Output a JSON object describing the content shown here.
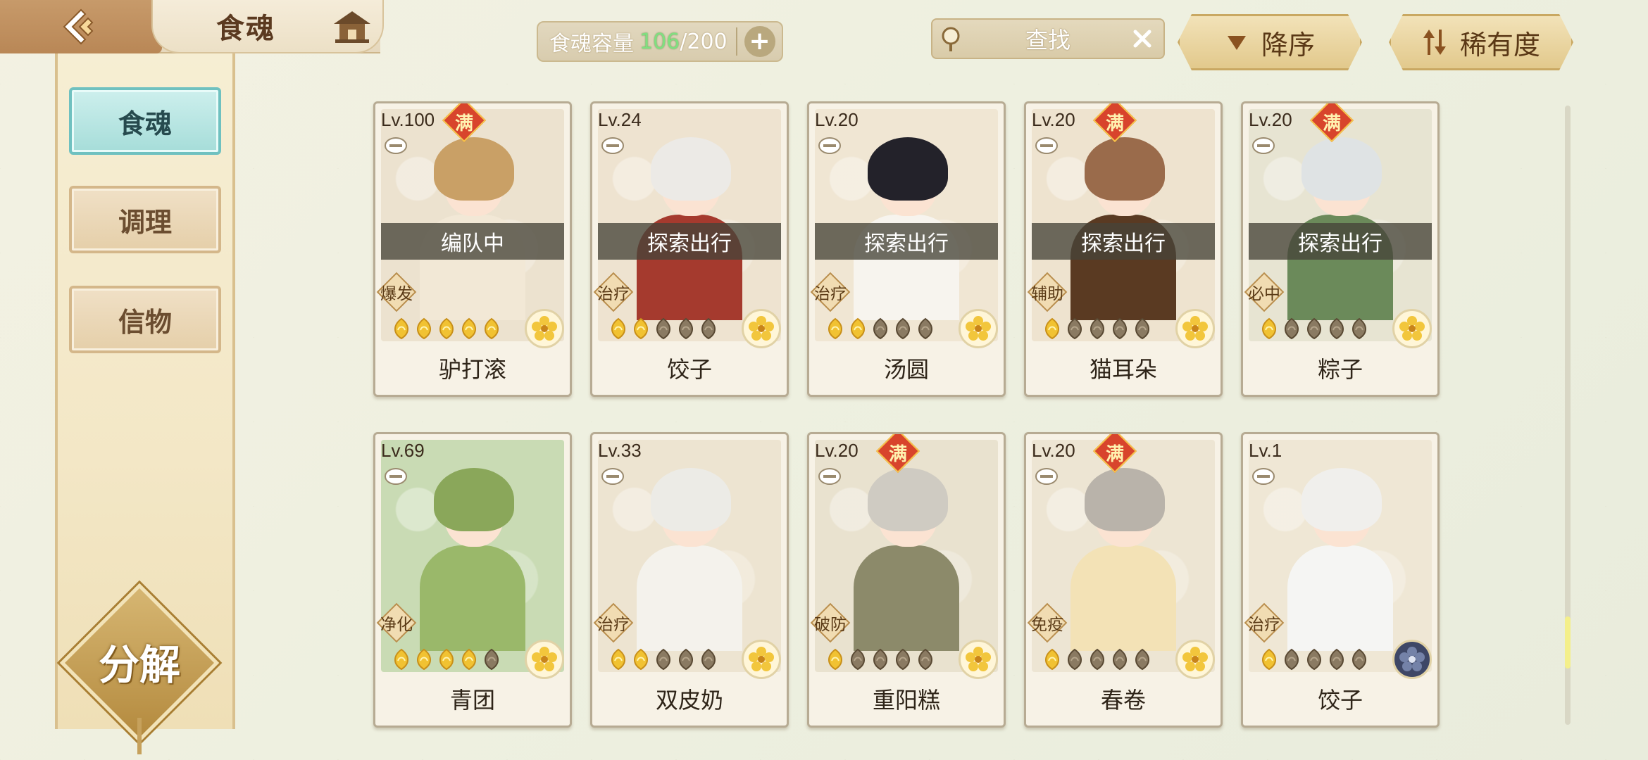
{
  "header": {
    "title": "食魂",
    "capacity_label": "食魂容量",
    "capacity_current": "106",
    "capacity_sep": "/",
    "capacity_max": "200",
    "search_label": "查找",
    "sort_order_label": "降序",
    "sort_key_label": "稀有度"
  },
  "sidebar": {
    "tabs": [
      {
        "label": "食魂",
        "active": true
      },
      {
        "label": "调理",
        "active": false
      },
      {
        "label": "信物",
        "active": false
      }
    ],
    "decompose_label": "分解"
  },
  "cards": [
    {
      "level": "Lv.100",
      "max": true,
      "max_label": "满",
      "status": "编队中",
      "role": "爆发",
      "stars": 5,
      "filled": 5,
      "rarity": "gold",
      "name": "驴打滚",
      "hair": "#c9a066",
      "outfit": "#f2e8d6",
      "bg": "#ece2cf"
    },
    {
      "level": "Lv.24",
      "max": false,
      "max_label": "",
      "status": "探索出行",
      "role": "治疗",
      "stars": 5,
      "filled": 2,
      "rarity": "gold",
      "name": "饺子",
      "hair": "#eceae6",
      "outfit": "#a53a2e",
      "bg": "#eee3d0"
    },
    {
      "level": "Lv.20",
      "max": false,
      "max_label": "",
      "status": "探索出行",
      "role": "治疗",
      "stars": 5,
      "filled": 2,
      "rarity": "gold",
      "name": "汤圆",
      "hair": "#23222a",
      "outfit": "#f7f4ee",
      "bg": "#f0e6d3"
    },
    {
      "level": "Lv.20",
      "max": true,
      "max_label": "满",
      "status": "探索出行",
      "role": "辅助",
      "stars": 5,
      "filled": 1,
      "rarity": "gold",
      "name": "猫耳朵",
      "hair": "#9a6b4b",
      "outfit": "#5a3a22",
      "bg": "#eee3cf"
    },
    {
      "level": "Lv.20",
      "max": true,
      "max_label": "满",
      "status": "探索出行",
      "role": "必中",
      "stars": 5,
      "filled": 1,
      "rarity": "gold",
      "name": "粽子",
      "hair": "#dfe3e4",
      "outfit": "#6b8a5a",
      "bg": "#e7e4d2"
    },
    {
      "level": "Lv.69",
      "max": false,
      "max_label": "",
      "status": "",
      "role": "净化",
      "stars": 5,
      "filled": 4,
      "rarity": "gold",
      "name": "青团",
      "hair": "#8aa75a",
      "outfit": "#9ab86a",
      "bg": "#c9dbb4"
    },
    {
      "level": "Lv.33",
      "max": false,
      "max_label": "",
      "status": "",
      "role": "治疗",
      "stars": 5,
      "filled": 2,
      "rarity": "gold",
      "name": "双皮奶",
      "hair": "#ecebe6",
      "outfit": "#f4f2ec",
      "bg": "#ede4d1"
    },
    {
      "level": "Lv.20",
      "max": true,
      "max_label": "满",
      "status": "",
      "role": "破防",
      "stars": 5,
      "filled": 1,
      "rarity": "gold",
      "name": "重阳糕",
      "hair": "#cfcbc2",
      "outfit": "#8c8a6a",
      "bg": "#e9e2cf"
    },
    {
      "level": "Lv.20",
      "max": true,
      "max_label": "满",
      "status": "",
      "role": "免疫",
      "stars": 5,
      "filled": 1,
      "rarity": "gold",
      "name": "春卷",
      "hair": "#b9b3aa",
      "outfit": "#f3e2b6",
      "bg": "#ede5d3"
    },
    {
      "level": "Lv.1",
      "max": false,
      "max_label": "",
      "status": "",
      "role": "治疗",
      "stars": 5,
      "filled": 1,
      "rarity": "silver",
      "name": "饺子",
      "hair": "#f0efec",
      "outfit": "#f5f5f3",
      "bg": "#efe7d5"
    }
  ],
  "colors": {
    "accent": "#6fc1c0",
    "gold": "#e7b933",
    "max_badge": "#d8442c"
  },
  "icons": {
    "back": "back-arrow-icon",
    "home": "home-icon",
    "search": "search-icon",
    "clear": "close-icon",
    "sort_desc": "triangle-down-icon",
    "sort_rarity": "sort-arrows-icon"
  }
}
